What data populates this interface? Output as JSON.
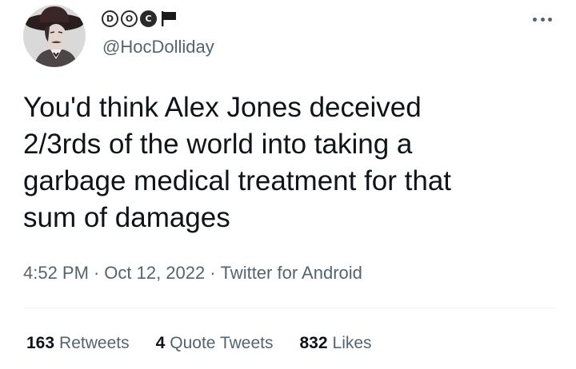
{
  "author": {
    "display_name_letters": [
      "D",
      "O",
      "C"
    ],
    "handle": "@HocDolliday"
  },
  "tweet": {
    "text": "You'd think Alex Jones deceived\n2/3rds of the world into taking a\ngarbage medical treatment for that\nsum of damages"
  },
  "meta": {
    "time": "4:52 PM",
    "date": "Oct 12, 2022",
    "source": "Twitter for Android",
    "separator": "·"
  },
  "stats": {
    "retweets_count": "163",
    "retweets_label": "Retweets",
    "quotes_count": "4",
    "quotes_label": "Quote Tweets",
    "likes_count": "832",
    "likes_label": "Likes"
  },
  "icons": {
    "avatar": "avatar-image",
    "flag": "flag-icon",
    "more": "more-options-icon"
  },
  "colors": {
    "text_primary": "#0f1419",
    "text_secondary": "#536471",
    "divider": "#eff3f4"
  }
}
